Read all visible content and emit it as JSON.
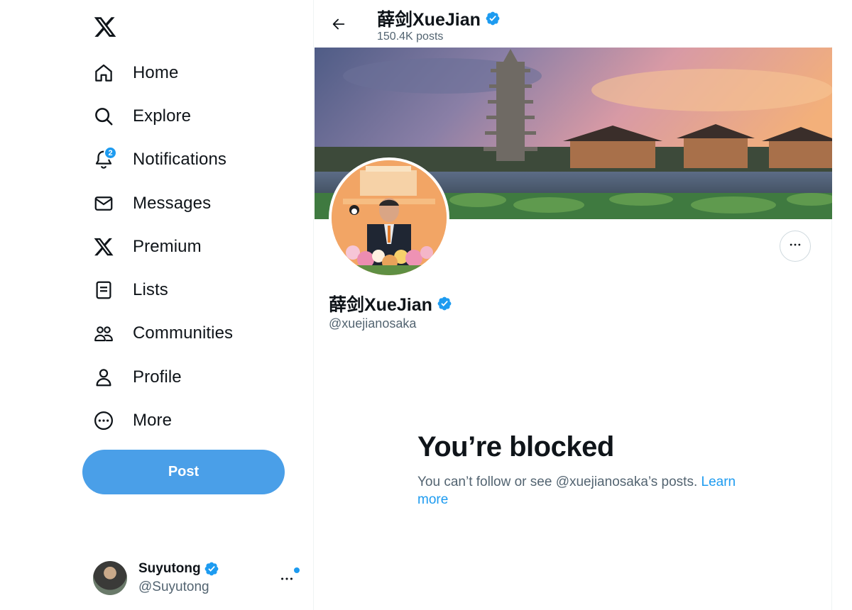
{
  "sidebar": {
    "logo": "x-logo-icon",
    "nav": [
      {
        "label": "Home",
        "icon": "home-icon"
      },
      {
        "label": "Explore",
        "icon": "search-icon"
      },
      {
        "label": "Notifications",
        "icon": "bell-icon",
        "badge": "2"
      },
      {
        "label": "Messages",
        "icon": "envelope-icon"
      },
      {
        "label": "Premium",
        "icon": "x-logo-icon"
      },
      {
        "label": "Lists",
        "icon": "list-icon"
      },
      {
        "label": "Communities",
        "icon": "people-icon"
      },
      {
        "label": "Profile",
        "icon": "person-icon"
      },
      {
        "label": "More",
        "icon": "more-circle-icon"
      }
    ],
    "post_label": "Post",
    "account": {
      "name": "Suyutong",
      "handle": "@Suyutong"
    }
  },
  "header": {
    "name": "薛剑XueJian",
    "posts": "150.4K posts"
  },
  "profile": {
    "name": "薛剑XueJian",
    "handle": "@xuejianosaka"
  },
  "blocked": {
    "title": "You’re blocked",
    "description": "You can’t follow or see @xuejianosaka’s posts.",
    "link": "Learn more"
  },
  "colors": {
    "accent": "#1d9bf0",
    "post_button": "#4a9fe8",
    "text": "#0f1419",
    "muted": "#536471"
  }
}
